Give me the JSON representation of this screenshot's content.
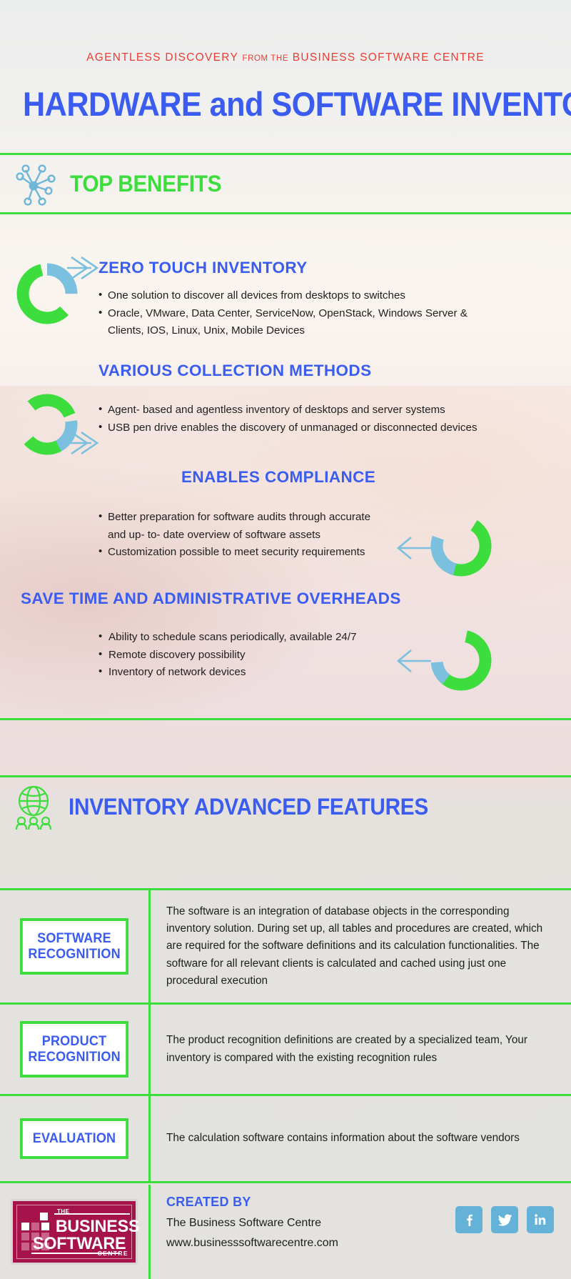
{
  "header": {
    "kicker_part1": "AGENTLESS  DISCOVERY",
    "kicker_small": "FROM THE",
    "kicker_part2": "BUSINESS  SOFTWARE  CENTRE",
    "title": "HARDWARE and SOFTWARE INVENTORY"
  },
  "sections": {
    "top_benefits": "TOP BENEFITS",
    "advanced_features": "INVENTORY ADVANCED FEATURES"
  },
  "benefits": [
    {
      "title": "ZERO TOUCH INVENTORY",
      "bullets": [
        "One solution to discover all devices from desktops to switches",
        "Oracle, VMware, Data Center, ServiceNow, OpenStack, Windows Server & Clients, IOS, Linux, Unix, Mobile Devices"
      ]
    },
    {
      "title": "VARIOUS COLLECTION METHODS",
      "bullets": [
        "Agent- based and agentless inventory of desktops and server systems",
        "USB pen drive enables the discovery of unmanaged or disconnected devices"
      ]
    },
    {
      "title": "ENABLES COMPLIANCE",
      "bullets": [
        "Better preparation for software audits through accurate and up- to- date overview of software assets",
        "Customization possible to meet security requirements"
      ]
    },
    {
      "title": "SAVE TIME AND ADMINISTRATIVE OVERHEADS",
      "bullets": [
        "Ability to schedule scans periodically, available 24/7",
        "Remote discovery possibility",
        "Inventory of network devices"
      ]
    }
  ],
  "features": [
    {
      "badge_line1": "SOFTWARE",
      "badge_line2": "RECOGNITION",
      "description": "The software is an integration of database objects in the corresponding inventory solution. During set up, all tables and procedures are created, which are required for the software definitions and its calculation functionalities. The software for all relevant clients is calculated and cached using just one procedural execution"
    },
    {
      "badge_line1": "PRODUCT",
      "badge_line2": "RECOGNITION",
      "description": "The product recognition definitions are created by a specialized team, Your inventory is compared with the existing recognition rules"
    },
    {
      "badge_line1": "EVALUATION",
      "badge_line2": "",
      "description": "The calculation software contains information about the software vendors"
    }
  ],
  "footer": {
    "logo_the": "THE",
    "logo_word1": "BUSINESS",
    "logo_word2": "SOFTWARE",
    "logo_centre": "CENTRE",
    "created_by": "CREATED BY",
    "company": "The Business Software Centre",
    "website": "www.businesssoftwarecentre.com",
    "social": [
      {
        "name": "facebook-icon",
        "glyph": "f"
      },
      {
        "name": "twitter-icon",
        "glyph": "🐦"
      },
      {
        "name": "linkedin-icon",
        "glyph": "in"
      }
    ]
  },
  "colors": {
    "accent_green": "#3ddd3d",
    "accent_blue": "#3b5cf0",
    "accent_red": "#ee3b33",
    "donut_blue": "#7bc0de",
    "logo_maroon": "#a5134a"
  }
}
